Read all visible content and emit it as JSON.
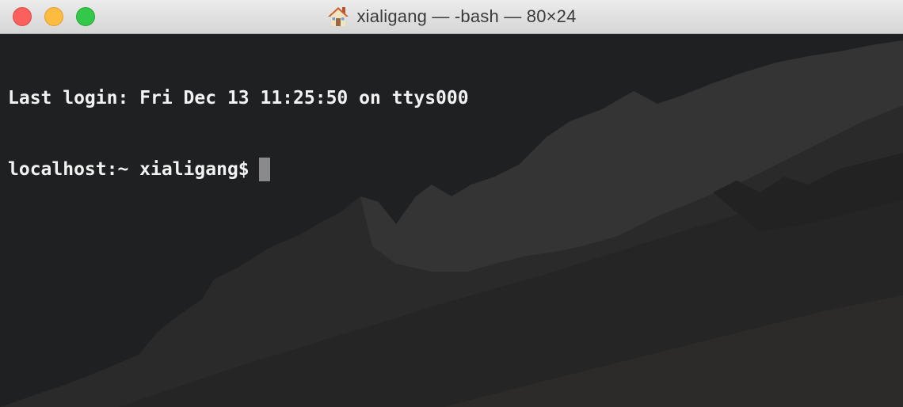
{
  "window": {
    "title": "xialigang — -bash — 80×24"
  },
  "title_icon": "home-icon",
  "terminal": {
    "lines": [
      "Last login: Fri Dec 13 11:25:50 on ttys000"
    ],
    "prompt": "localhost:~ xialigang$"
  },
  "colors": {
    "close": "#fc605c",
    "minimize": "#fdbc40",
    "maximize": "#34c84a",
    "terminal_bg": "#1f2022",
    "terminal_text": "#f2f2f2",
    "cursor": "#8a8a8a"
  }
}
